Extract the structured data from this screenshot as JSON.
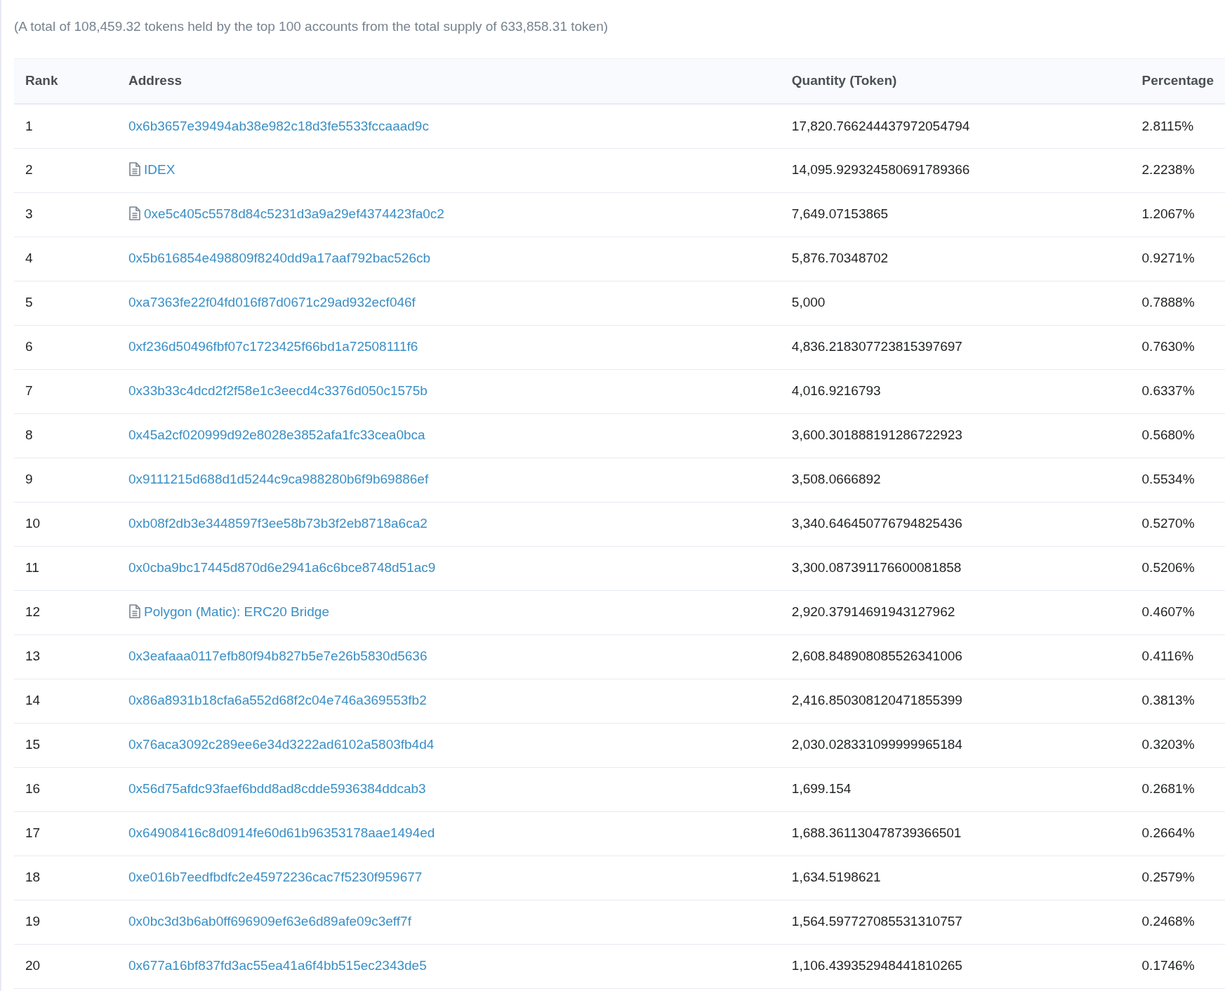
{
  "summary": "(A total of 108,459.32 tokens held by the top 100 accounts from the total supply of 633,858.31 token)",
  "table": {
    "columns": [
      "Rank",
      "Address",
      "Quantity (Token)",
      "Percentage"
    ],
    "rows": [
      {
        "rank": "1",
        "kind": "address",
        "address": "0x6b3657e39494ab38e982c18d3fe5533fccaaad9c",
        "quantity": "17,820.766244437972054794",
        "percentage": "2.8115%"
      },
      {
        "rank": "2",
        "kind": "contract",
        "address": "IDEX",
        "quantity": "14,095.929324580691789366",
        "percentage": "2.2238%"
      },
      {
        "rank": "3",
        "kind": "contract",
        "address": "0xe5c405c5578d84c5231d3a9a29ef4374423fa0c2",
        "quantity": "7,649.07153865",
        "percentage": "1.2067%"
      },
      {
        "rank": "4",
        "kind": "address",
        "address": "0x5b616854e498809f8240dd9a17aaf792bac526cb",
        "quantity": "5,876.70348702",
        "percentage": "0.9271%"
      },
      {
        "rank": "5",
        "kind": "address",
        "address": "0xa7363fe22f04fd016f87d0671c29ad932ecf046f",
        "quantity": "5,000",
        "percentage": "0.7888%"
      },
      {
        "rank": "6",
        "kind": "address",
        "address": "0xf236d50496fbf07c1723425f66bd1a72508111f6",
        "quantity": "4,836.218307723815397697",
        "percentage": "0.7630%"
      },
      {
        "rank": "7",
        "kind": "address",
        "address": "0x33b33c4dcd2f2f58e1c3eecd4c3376d050c1575b",
        "quantity": "4,016.9216793",
        "percentage": "0.6337%"
      },
      {
        "rank": "8",
        "kind": "address",
        "address": "0x45a2cf020999d92e8028e3852afa1fc33cea0bca",
        "quantity": "3,600.301888191286722923",
        "percentage": "0.5680%"
      },
      {
        "rank": "9",
        "kind": "address",
        "address": "0x9111215d688d1d5244c9ca988280b6f9b69886ef",
        "quantity": "3,508.0666892",
        "percentage": "0.5534%"
      },
      {
        "rank": "10",
        "kind": "address",
        "address": "0xb08f2db3e3448597f3ee58b73b3f2eb8718a6ca2",
        "quantity": "3,340.646450776794825436",
        "percentage": "0.5270%"
      },
      {
        "rank": "11",
        "kind": "address",
        "address": "0x0cba9bc17445d870d6e2941a6c6bce8748d51ac9",
        "quantity": "3,300.087391176600081858",
        "percentage": "0.5206%"
      },
      {
        "rank": "12",
        "kind": "contract",
        "address": "Polygon (Matic): ERC20 Bridge",
        "quantity": "2,920.37914691943127962",
        "percentage": "0.4607%"
      },
      {
        "rank": "13",
        "kind": "address",
        "address": "0x3eafaaa0117efb80f94b827b5e7e26b5830d5636",
        "quantity": "2,608.848908085526341006",
        "percentage": "0.4116%"
      },
      {
        "rank": "14",
        "kind": "address",
        "address": "0x86a8931b18cfa6a552d68f2c04e746a369553fb2",
        "quantity": "2,416.850308120471855399",
        "percentage": "0.3813%"
      },
      {
        "rank": "15",
        "kind": "address",
        "address": "0x76aca3092c289ee6e34d3222ad6102a5803fb4d4",
        "quantity": "2,030.028331099999965184",
        "percentage": "0.3203%"
      },
      {
        "rank": "16",
        "kind": "address",
        "address": "0x56d75afdc93faef6bdd8ad8cdde5936384ddcab3",
        "quantity": "1,699.154",
        "percentage": "0.2681%"
      },
      {
        "rank": "17",
        "kind": "address",
        "address": "0x64908416c8d0914fe60d61b96353178aae1494ed",
        "quantity": "1,688.361130478739366501",
        "percentage": "0.2664%"
      },
      {
        "rank": "18",
        "kind": "address",
        "address": "0xe016b7eedfbdfc2e45972236cac7f5230f959677",
        "quantity": "1,634.5198621",
        "percentage": "0.2579%"
      },
      {
        "rank": "19",
        "kind": "address",
        "address": "0x0bc3d3b6ab0ff696909ef63e6d89afe09c3eff7f",
        "quantity": "1,564.597727085531310757",
        "percentage": "0.2468%"
      },
      {
        "rank": "20",
        "kind": "address",
        "address": "0x677a16bf837fd3ac55ea41a6f4bb515ec2343de5",
        "quantity": "1,106.439352948441810265",
        "percentage": "0.1746%"
      }
    ]
  }
}
